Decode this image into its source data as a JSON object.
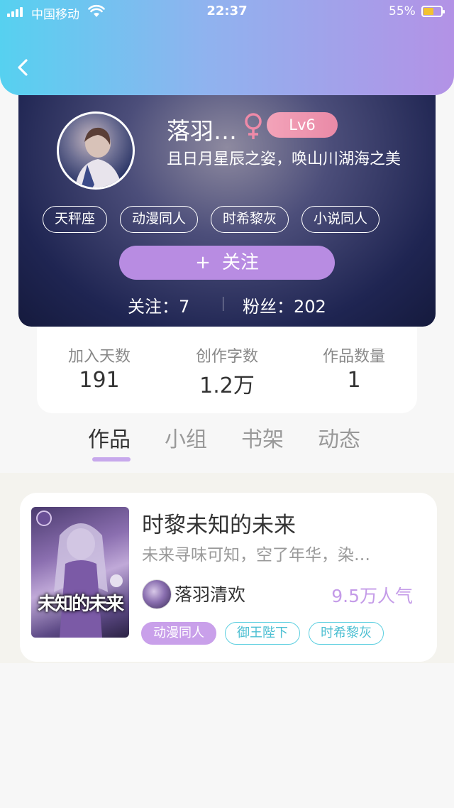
{
  "status_bar": {
    "carrier": "中国移动",
    "time": "22:37",
    "battery": "55%"
  },
  "profile": {
    "nickname": "落羽…",
    "level": "Lv6",
    "signature": "且日月星辰之姿，唤山川湖海之美",
    "tags": [
      "天秤座",
      "动漫同人",
      "时希黎灰",
      "小说同人"
    ],
    "follow_button": "关注",
    "follow_plus": "+",
    "following_text": "关注：7",
    "fans_text": "粉丝：202"
  },
  "stats": [
    {
      "label": "加入天数",
      "value": "191"
    },
    {
      "label": "创作字数",
      "value": "1.2万"
    },
    {
      "label": "作品数量",
      "value": "1"
    }
  ],
  "tabs": [
    "作品",
    "小组",
    "书架",
    "动态"
  ],
  "work": {
    "cover_text": "未知的未来",
    "title": "时黎未知的未来",
    "description": "未来寻味可知，空了年华，染…",
    "author": "落羽清欢",
    "popularity": "9.5万人气",
    "tags": [
      "动漫同人",
      "御王陛下",
      "时希黎灰"
    ]
  },
  "colors": {
    "header_gradient_start": "#56d1f0",
    "header_gradient_end": "#b392e6",
    "accent_purple": "#b88ce2",
    "level_pink": "#ee96b0",
    "tag_cyan": "#5ccfe0"
  }
}
